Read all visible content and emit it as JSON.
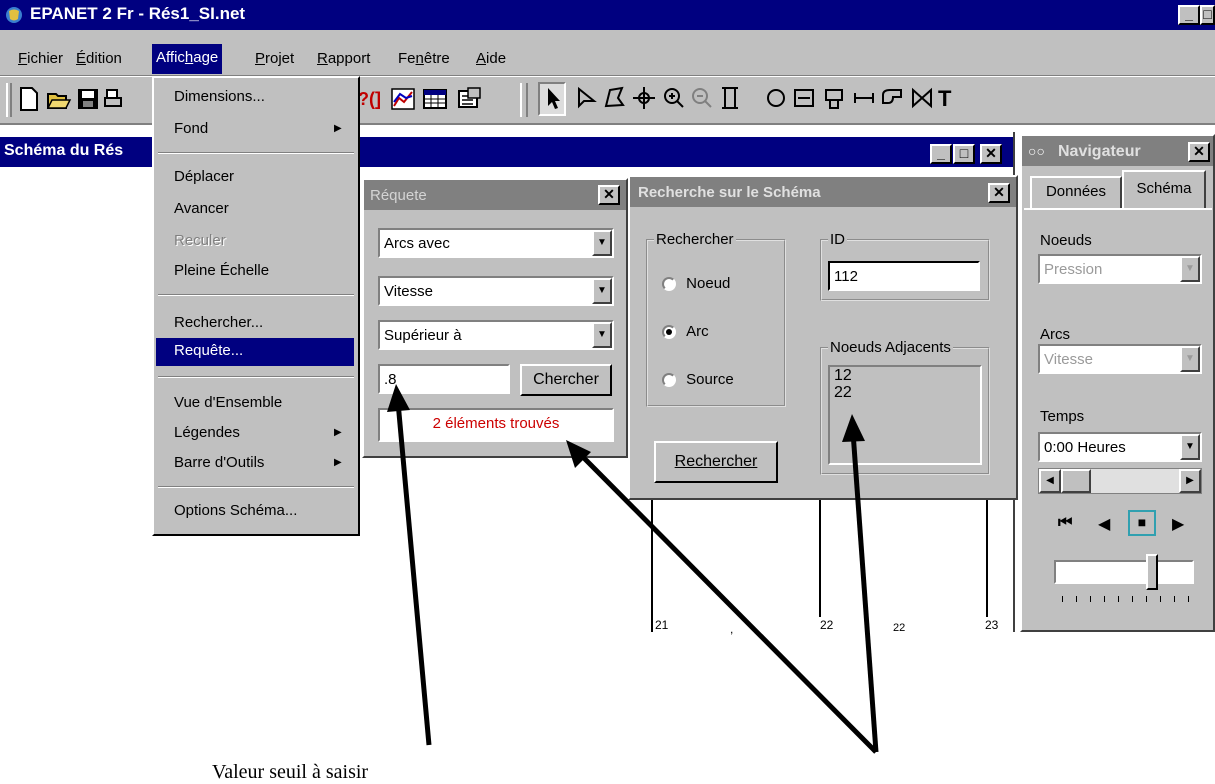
{
  "app": {
    "title": "EPANET 2 Fr - Rés1_SI.net"
  },
  "menubar": {
    "items": [
      "Fichier",
      "Édition",
      "Affichage",
      "Projet",
      "Rapport",
      "Fenêtre",
      "Aide"
    ]
  },
  "toolbar": {
    "text_tool": "T"
  },
  "schema_window": {
    "title": "Schéma du Rés",
    "node_labels": [
      "21",
      "22",
      "22",
      "23"
    ]
  },
  "affichage_menu": {
    "items": [
      {
        "label": "Dimensions...",
        "submenu": false,
        "disabled": false,
        "highlighted": false
      },
      {
        "label": "Fond",
        "submenu": true,
        "disabled": false,
        "highlighted": false
      },
      {
        "label": "Déplacer",
        "submenu": false,
        "disabled": false,
        "highlighted": false
      },
      {
        "label": "Avancer",
        "submenu": false,
        "disabled": false,
        "highlighted": false
      },
      {
        "label": "Reculer",
        "submenu": false,
        "disabled": true,
        "highlighted": false
      },
      {
        "label": "Pleine Échelle",
        "submenu": false,
        "disabled": false,
        "highlighted": false
      },
      {
        "label": "Rechercher...",
        "submenu": false,
        "disabled": false,
        "highlighted": false
      },
      {
        "label": "Requête...",
        "submenu": false,
        "disabled": false,
        "highlighted": true
      },
      {
        "label": "Vue d'Ensemble",
        "submenu": false,
        "disabled": false,
        "highlighted": false
      },
      {
        "label": "Légendes",
        "submenu": true,
        "disabled": false,
        "highlighted": false
      },
      {
        "label": "Barre d'Outils",
        "submenu": true,
        "disabled": false,
        "highlighted": false
      },
      {
        "label": "Options Schéma...",
        "submenu": false,
        "disabled": false,
        "highlighted": false
      }
    ]
  },
  "query_dialog": {
    "title": "Réquete",
    "object_select": "Arcs avec",
    "parameter_select": "Vitesse",
    "relation_select": "Supérieur à",
    "value_input": ".8",
    "search_button": "Chercher",
    "result_text": "2 éléments trouvés"
  },
  "find_dialog": {
    "title": "Recherche sur le Schéma",
    "group_label": "Rechercher",
    "options": [
      "Noeud",
      "Arc",
      "Source"
    ],
    "selected_option": "Arc",
    "id_label": "ID",
    "id_value": "112",
    "adjacent_label": "Noeuds Adjacents",
    "adjacent_nodes": [
      "12",
      "22"
    ],
    "search_button": "Rechercher"
  },
  "browser": {
    "title": "Navigateur",
    "tabs": [
      "Données",
      "Schéma"
    ],
    "active_tab": "Schéma",
    "nodes_label": "Noeuds",
    "nodes_value": "Pression",
    "links_label": "Arcs",
    "links_value": "Vitesse",
    "time_label": "Temps",
    "time_value": "0:00 Heures"
  },
  "annotations": {
    "threshold_caption": "Valeur seuil à saisir",
    "colors": {
      "arrow": "#000000",
      "result_text": "#cc0000",
      "highlight": "#000080"
    }
  }
}
